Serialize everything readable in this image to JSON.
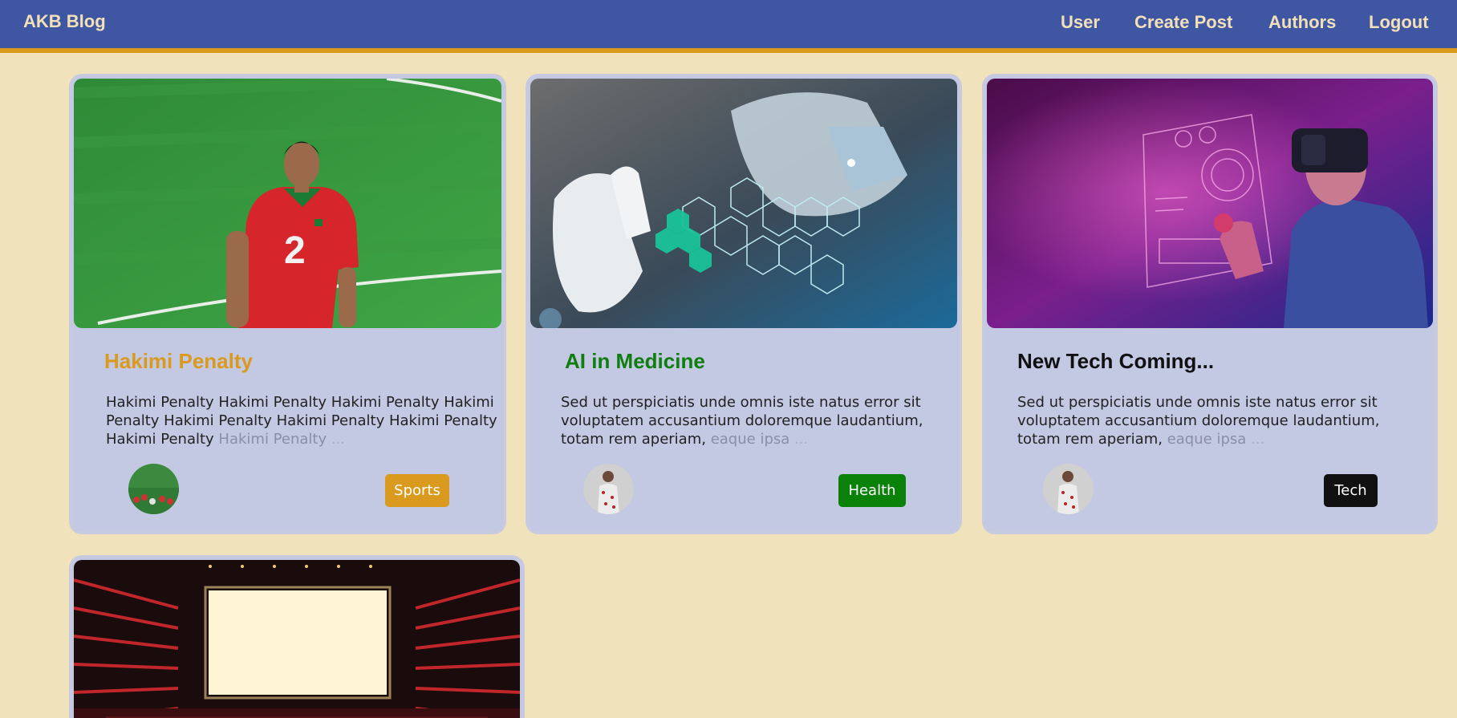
{
  "nav": {
    "brand": "AKB Blog",
    "links": [
      "User",
      "Create Post",
      "Authors",
      "Logout"
    ]
  },
  "posts": [
    {
      "title": "Hakimi Penalty",
      "title_color": "#d99a1e",
      "excerpt": "Hakimi Penalty Hakimi Penalty Hakimi Penalty Hakimi Penalty Hakimi Penalty Hakimi Penalty Hakimi Penalty Hakimi Penalty",
      "excerpt_faded": "Hakimi Penalty",
      "ellipsis": "...",
      "category": "Sports",
      "category_color": "#d99a1e",
      "image": "football-player-photo"
    },
    {
      "title": "AI in Medicine",
      "title_color": "#0f7d0f",
      "excerpt": "Sed ut perspiciatis unde omnis iste natus error sit voluptatem accusantium doloremque laudantium, totam rem aperiam,",
      "excerpt_faded": "eaque ipsa",
      "ellipsis": "...",
      "category": "Health",
      "category_color": "#0a820a",
      "image": "medical-tech-photo"
    },
    {
      "title": "New Tech Coming...",
      "title_color": "#111111",
      "excerpt": "Sed ut perspiciatis unde omnis iste natus error sit voluptatem accusantium doloremque laudantium, totam rem aperiam,",
      "excerpt_faded": "eaque ipsa",
      "ellipsis": "...",
      "category": "Tech",
      "category_color": "#111111",
      "image": "vr-headset-photo"
    },
    {
      "image": "cinema-screen-photo"
    }
  ]
}
